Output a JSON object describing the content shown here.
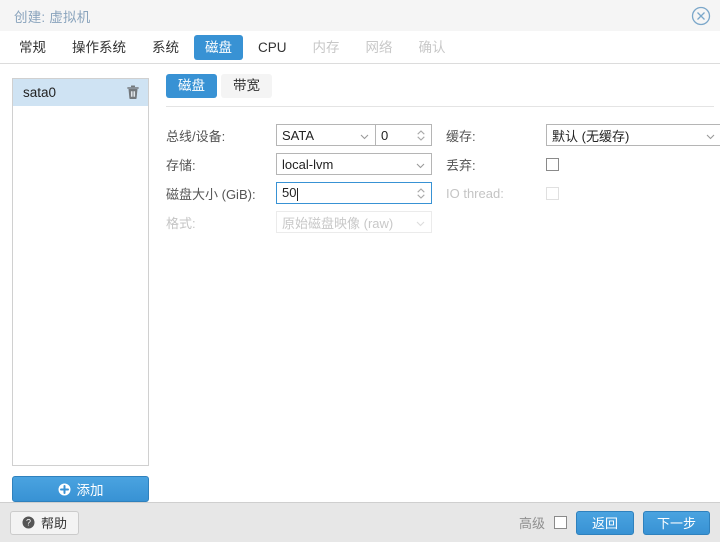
{
  "window": {
    "title": "创建: 虚拟机",
    "close_icon": "close-circle-icon"
  },
  "tabs": [
    {
      "label": "常规",
      "state": "enabled"
    },
    {
      "label": "操作系统",
      "state": "enabled"
    },
    {
      "label": "系统",
      "state": "enabled"
    },
    {
      "label": "磁盘",
      "state": "active"
    },
    {
      "label": "CPU",
      "state": "enabled"
    },
    {
      "label": "内存",
      "state": "disabled"
    },
    {
      "label": "网络",
      "state": "disabled"
    },
    {
      "label": "确认",
      "state": "disabled"
    }
  ],
  "device_list": {
    "items": [
      {
        "label": "sata0",
        "selected": true,
        "delete_icon": "trash-icon"
      }
    ],
    "add_button": {
      "label": "添加",
      "icon": "plus-circle-icon"
    }
  },
  "subtabs": [
    {
      "label": "磁盘",
      "state": "active"
    },
    {
      "label": "带宽",
      "state": "enabled"
    }
  ],
  "form": {
    "left": {
      "bus_device": {
        "label": "总线/设备:",
        "bus_value": "SATA",
        "device_value": "0"
      },
      "storage": {
        "label": "存储:",
        "value": "local-lvm"
      },
      "disk_size": {
        "label": "磁盘大小 (GiB):",
        "value": "50",
        "focused": true
      },
      "format": {
        "label": "格式:",
        "value": "原始磁盘映像 (raw)",
        "disabled": true
      }
    },
    "right": {
      "cache": {
        "label": "缓存:",
        "value": "默认 (无缓存)"
      },
      "discard": {
        "label": "丢弃:",
        "checked": false,
        "disabled": false
      },
      "io_thread": {
        "label": "IO thread:",
        "checked": false,
        "disabled": true
      }
    }
  },
  "footer": {
    "help_label": "帮助",
    "help_icon": "question-circle-icon",
    "advanced_label": "高级",
    "advanced_checked": false,
    "back_label": "返回",
    "next_label": "下一步"
  },
  "colors": {
    "accent": "#3892d4",
    "title_text": "#8aa4bd",
    "selection": "#cfe3f3",
    "footer_bg": "#e7e7e7",
    "disabled_text": "#c8c8c8"
  }
}
